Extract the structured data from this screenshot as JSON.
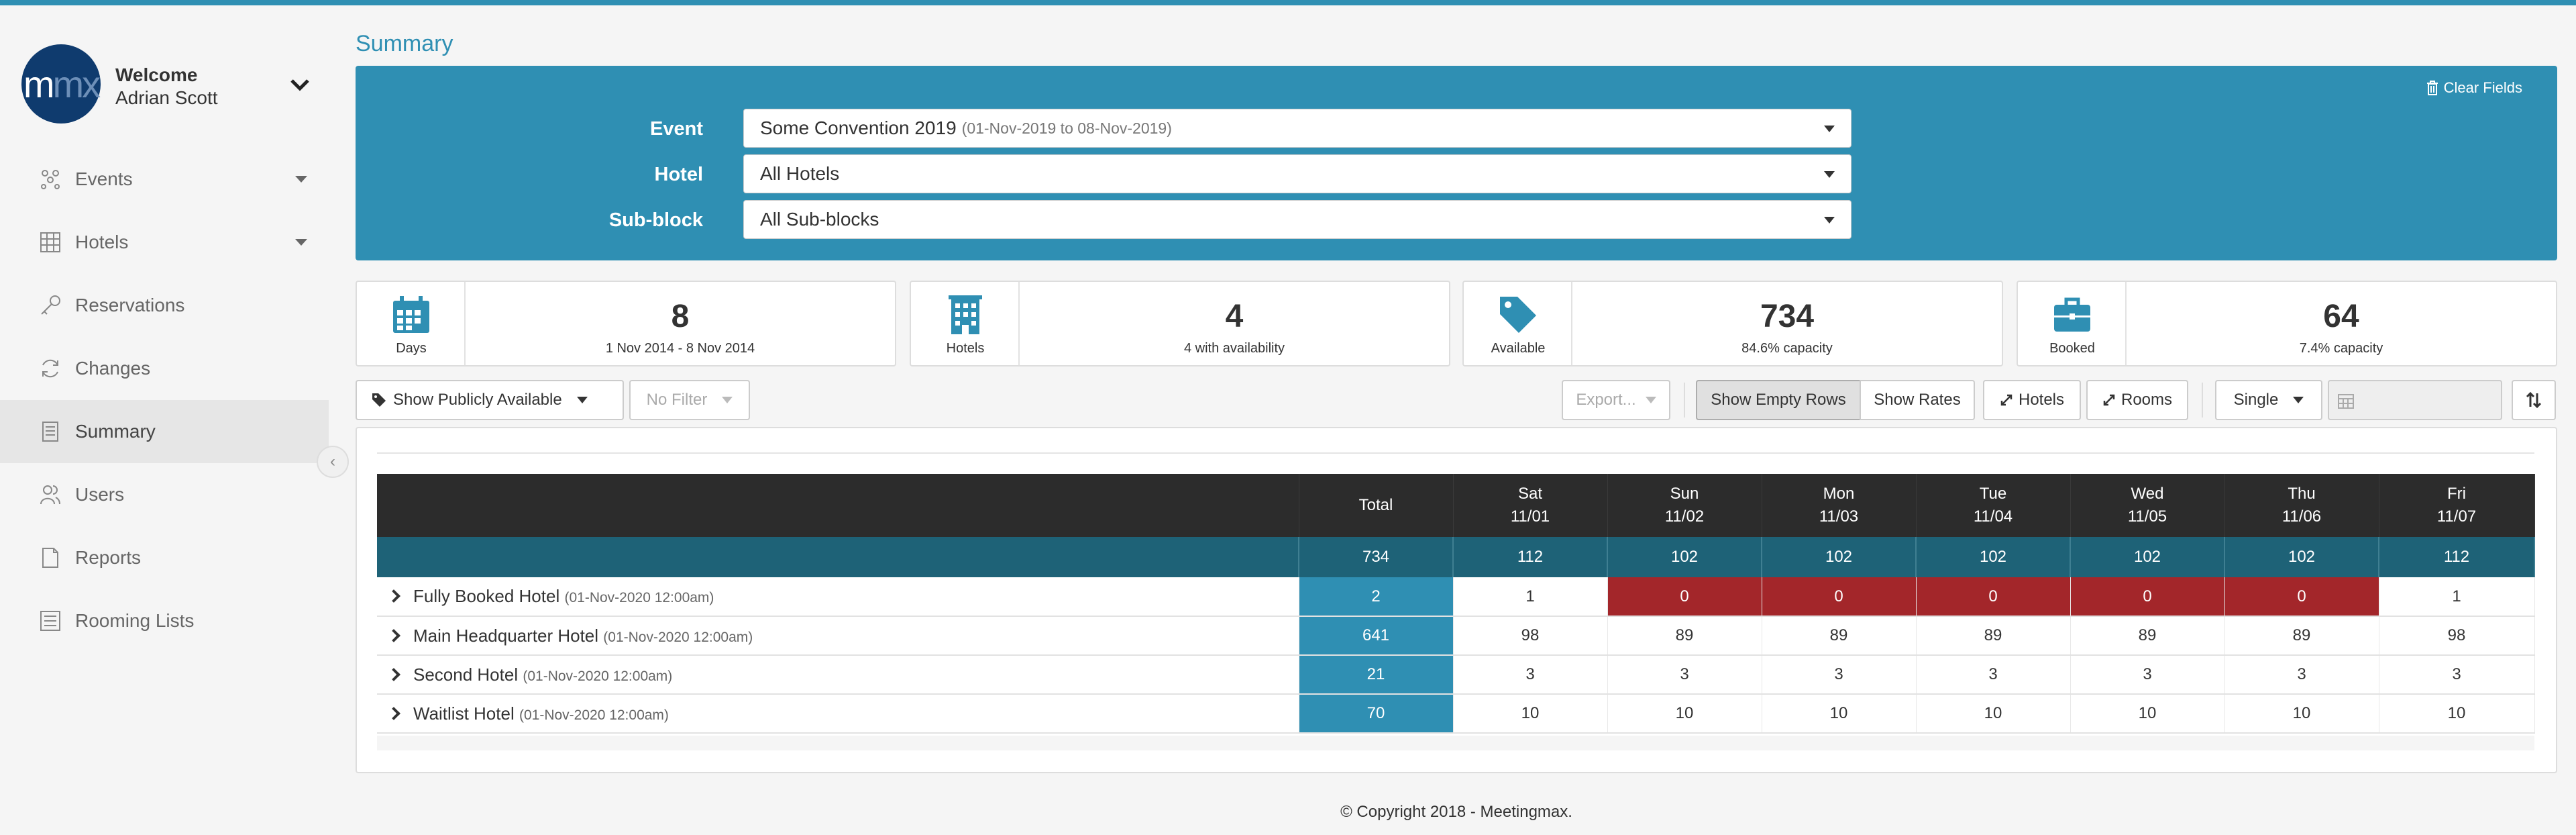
{
  "sidebar": {
    "avatar": {
      "m": "m",
      "x": "mx"
    },
    "welcome": "Welcome",
    "user_name": "Adrian Scott",
    "items": [
      {
        "label": "Events",
        "icon": "events-icon",
        "has_caret": true
      },
      {
        "label": "Hotels",
        "icon": "hotels-icon",
        "has_caret": true
      },
      {
        "label": "Reservations",
        "icon": "key-icon"
      },
      {
        "label": "Changes",
        "icon": "refresh-icon"
      },
      {
        "label": "Summary",
        "icon": "document-icon",
        "active": true
      },
      {
        "label": "Users",
        "icon": "users-icon"
      },
      {
        "label": "Reports",
        "icon": "report-icon"
      },
      {
        "label": "Rooming Lists",
        "icon": "list-icon"
      }
    ]
  },
  "page": {
    "title": "Summary"
  },
  "filters": {
    "clear_label": "Clear Fields",
    "event": {
      "label": "Event",
      "value": "Some Convention 2019",
      "sub": "(01-Nov-2019 to 08-Nov-2019)"
    },
    "hotel": {
      "label": "Hotel",
      "value": "All Hotels"
    },
    "subblock": {
      "label": "Sub-block",
      "value": "All Sub-blocks"
    }
  },
  "stats": [
    {
      "label": "Days",
      "value": "8",
      "sub": "1 Nov 2014 - 8 Nov 2014",
      "icon": "calendar-icon"
    },
    {
      "label": "Hotels",
      "value": "4",
      "sub": "4 with availability",
      "icon": "building-icon"
    },
    {
      "label": "Available",
      "value": "734",
      "sub": "84.6% capacity",
      "icon": "tag-icon"
    },
    {
      "label": "Booked",
      "value": "64",
      "sub": "7.4% capacity",
      "icon": "briefcase-icon"
    }
  ],
  "toolbar": {
    "availability": "Show Publicly Available",
    "filter": "No Filter",
    "export": "Export...",
    "show_empty_rows": "Show Empty Rows",
    "show_rates": "Show Rates",
    "hotels": "Hotels",
    "rooms": "Rooms",
    "occupancy": "Single"
  },
  "grid": {
    "total_header": "Total",
    "days": [
      {
        "dow": "Sat",
        "date": "11/01"
      },
      {
        "dow": "Sun",
        "date": "11/02"
      },
      {
        "dow": "Mon",
        "date": "11/03"
      },
      {
        "dow": "Tue",
        "date": "11/04"
      },
      {
        "dow": "Wed",
        "date": "11/05"
      },
      {
        "dow": "Thu",
        "date": "11/06"
      },
      {
        "dow": "Fri",
        "date": "11/07"
      }
    ],
    "totals": {
      "total": "734",
      "values": [
        "112",
        "102",
        "102",
        "102",
        "102",
        "102",
        "112"
      ]
    },
    "rows": [
      {
        "name": "Fully Booked Hotel",
        "when": "(01-Nov-2020 12:00am)",
        "total": "2",
        "values": [
          "1",
          "0",
          "0",
          "0",
          "0",
          "0",
          "1"
        ]
      },
      {
        "name": "Main Headquarter Hotel",
        "when": "(01-Nov-2020 12:00am)",
        "total": "641",
        "values": [
          "98",
          "89",
          "89",
          "89",
          "89",
          "89",
          "98"
        ]
      },
      {
        "name": "Second Hotel",
        "when": "(01-Nov-2020 12:00am)",
        "total": "21",
        "values": [
          "3",
          "3",
          "3",
          "3",
          "3",
          "3",
          "3"
        ]
      },
      {
        "name": "Waitlist Hotel",
        "when": "(01-Nov-2020 12:00am)",
        "total": "70",
        "values": [
          "10",
          "10",
          "10",
          "10",
          "10",
          "10",
          "10"
        ]
      }
    ],
    "colors": {
      "full": "#a3262a",
      "total": "#2f8fb3",
      "totals_row": "#1e6277"
    }
  },
  "footer": "© Copyright 2018 - Meetingmax."
}
